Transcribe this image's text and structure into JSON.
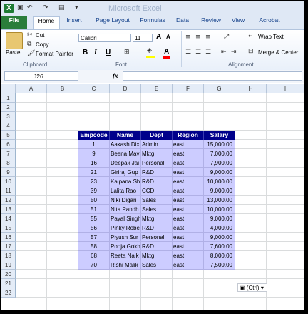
{
  "app": {
    "title": "Microsoft Excel",
    "icon": "excel-icon"
  },
  "quick_access": {
    "icons": [
      "save-icon",
      "undo-icon",
      "redo-icon",
      "format-painter-icon",
      "customize-icon"
    ]
  },
  "tabs": [
    "File",
    "Home",
    "Insert",
    "Page Layout",
    "Formulas",
    "Data",
    "Review",
    "View",
    "Acrobat"
  ],
  "ribbon": {
    "clipboard": {
      "paste": "Paste",
      "cut": "Cut",
      "copy": "Copy",
      "format_painter": "Format Painter",
      "group_label": "Clipboard"
    },
    "font": {
      "font_name": "Calibri",
      "font_size": "11",
      "grow": "A",
      "shrink": "A",
      "bold": "B",
      "italic": "I",
      "underline": "U",
      "fill_color": "#ffff00",
      "font_color": "#ff0000",
      "group_label": "Font"
    },
    "alignment": {
      "wrap_text": "Wrap Text",
      "merge_center": "Merge & Center",
      "group_label": "Alignment"
    }
  },
  "formula_bar": {
    "name_box": "J26",
    "fx": "fx",
    "value": ""
  },
  "columns": [
    "A",
    "B",
    "C",
    "D",
    "E",
    "F",
    "G",
    "H",
    "I"
  ],
  "rows": [
    "1",
    "2",
    "3",
    "4",
    "5",
    "6",
    "7",
    "8",
    "9",
    "10",
    "11",
    "12",
    "13",
    "14",
    "15",
    "16",
    "17",
    "18",
    "19",
    "20",
    "21",
    "22"
  ],
  "table": {
    "headers": [
      "Empcode",
      "Name",
      "Dept",
      "Region",
      "Salary"
    ],
    "rows": [
      [
        "1",
        "Aakash Dix",
        "Admin",
        "east",
        "15,000.00"
      ],
      [
        "9",
        "Beena Mav",
        "Mktg",
        "east",
        "7,000.00"
      ],
      [
        "16",
        "Deepak Jai",
        "Personal",
        "east",
        "7,900.00"
      ],
      [
        "21",
        "Giriraj Gup",
        "R&D",
        "east",
        "9,000.00"
      ],
      [
        "23",
        "Kalpana Sh",
        "R&D",
        "east",
        "10,000.00"
      ],
      [
        "39",
        "Lalita Rao",
        "CCD",
        "east",
        "9,000.00"
      ],
      [
        "50",
        "Niki Digari",
        "Sales",
        "east",
        "13,000.00"
      ],
      [
        "51",
        "Nita Pandh",
        "Sales",
        "east",
        "10,000.00"
      ],
      [
        "55",
        "Payal Singh",
        "Mktg",
        "east",
        "9,000.00"
      ],
      [
        "56",
        "Pinky Robe",
        "R&D",
        "east",
        "4,000.00"
      ],
      [
        "57",
        "Piyush Sur",
        "Personal",
        "east",
        "9,000.00"
      ],
      [
        "58",
        "Pooja Gokh",
        "R&D",
        "east",
        "7,600.00"
      ],
      [
        "68",
        "Reeta Naik",
        "Mktg",
        "east",
        "8,000.00"
      ],
      [
        "70",
        "Rishi Malik",
        "Sales",
        "east",
        "7,500.00"
      ]
    ]
  },
  "paste_options": {
    "label": "(Ctrl)"
  },
  "colors": {
    "header_bg": "#00008b",
    "header_text": "#ffffff",
    "data_bg": "#ccccff",
    "file_tab": "#2a7d3a"
  }
}
